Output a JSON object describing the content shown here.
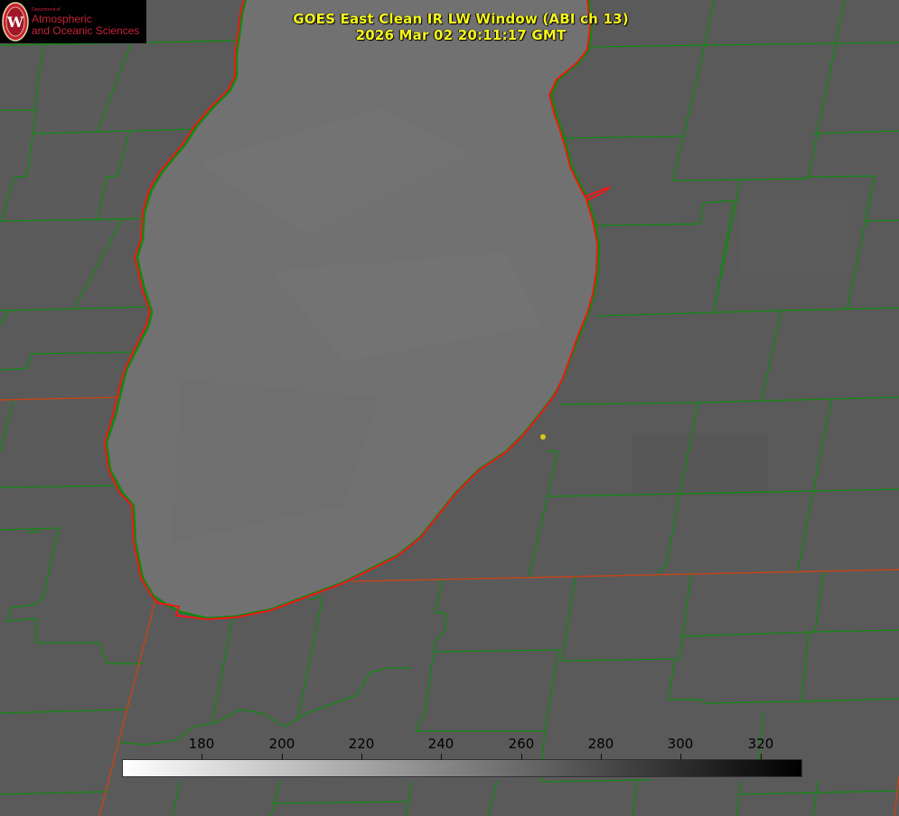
{
  "title": {
    "line1": "GOES East Clean IR LW Window (ABI ch 13)",
    "line2": "2026 Mar 02 20:11:17 GMT"
  },
  "logo": {
    "department": "Department of",
    "name_line1": "Atmospheric",
    "name_line2": "and Oceanic Sciences",
    "seal_letter": "W"
  },
  "colorbar": {
    "min": 160,
    "max": 330,
    "ticks": [
      180,
      200,
      220,
      240,
      260,
      280,
      300,
      320
    ],
    "color_low": "#ffffff",
    "color_high": "#000000"
  },
  "colors": {
    "land": "#5a5a5a",
    "lake": "#717171",
    "county_lines": "#0f8a0f",
    "state_lines": "#c0441a",
    "lake_outline": "#ff1010",
    "title_text": "#f7f71c",
    "marker": "#d8c818"
  },
  "map_elements": {
    "lake_name_icon": "lake-shape",
    "marker_icon": "city-dot-icon"
  }
}
